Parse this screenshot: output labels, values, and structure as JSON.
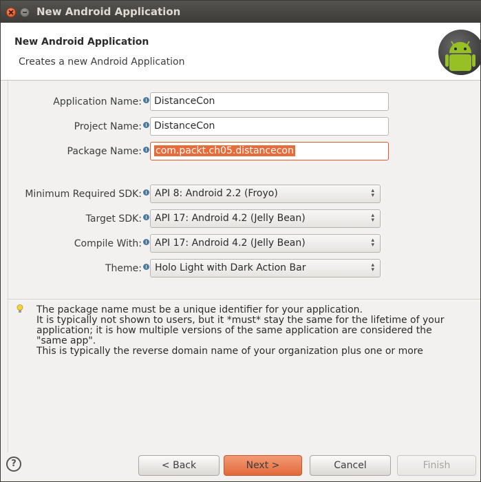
{
  "window": {
    "title": "New Android Application"
  },
  "banner": {
    "title": "New Android Application",
    "description": "Creates a new Android Application"
  },
  "form": {
    "app_name_label": "Application Name:",
    "app_name_value": "DistanceCon",
    "project_name_label": "Project Name:",
    "project_name_value": "DistanceCon",
    "package_name_label": "Package Name:",
    "package_name_value": "com.packt.ch05.distancecon",
    "min_sdk_label": "Minimum Required SDK:",
    "min_sdk_value": "API 8: Android 2.2 (Froyo)",
    "target_sdk_label": "Target SDK:",
    "target_sdk_value": "API 17: Android 4.2 (Jelly Bean)",
    "compile_with_label": "Compile With:",
    "compile_with_value": "API 17: Android 4.2 (Jelly Bean)",
    "theme_label": "Theme:",
    "theme_value": "Holo Light with Dark Action Bar"
  },
  "info": {
    "lines": [
      "The package name must be a unique identifier for your application.",
      "It is typically not shown to users, but it *must* stay the same for the lifetime of your",
      "application; it is how multiple versions of the same application are considered the",
      "\"same app\".",
      "This is typically the reverse domain name of your organization plus one or more"
    ]
  },
  "footer": {
    "help_label": "?",
    "back_label": "< Back",
    "next_label": "Next >",
    "cancel_label": "Cancel",
    "finish_label": "Finish"
  },
  "colors": {
    "accent": "#e86b3a",
    "titlebar": "#3c3b37",
    "info_icon": "#4a78a8"
  }
}
